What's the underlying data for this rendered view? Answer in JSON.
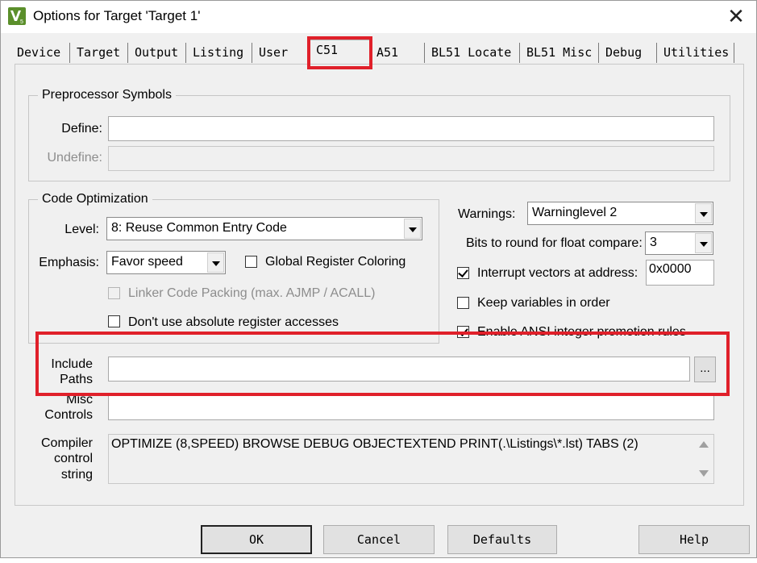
{
  "window": {
    "title": "Options for Target 'Target 1'",
    "close_symbol": "✕"
  },
  "tabs": [
    {
      "label": "Device"
    },
    {
      "label": "Target"
    },
    {
      "label": "Output"
    },
    {
      "label": "Listing"
    },
    {
      "label": "User"
    },
    {
      "label": "C51",
      "active": true
    },
    {
      "label": "A51"
    },
    {
      "label": "BL51 Locate"
    },
    {
      "label": "BL51 Misc"
    },
    {
      "label": "Debug"
    },
    {
      "label": "Utilities"
    }
  ],
  "preprocessor": {
    "title": "Preprocessor Symbols",
    "define_label": "Define:",
    "define_value": "",
    "undefine_label": "Undefine:",
    "undefine_value": ""
  },
  "optimization": {
    "title": "Code Optimization",
    "level_label": "Level:",
    "level_value": "8: Reuse Common Entry Code",
    "emphasis_label": "Emphasis:",
    "emphasis_value": "Favor speed",
    "global_register_coloring": {
      "label": "Global Register Coloring",
      "checked": false
    },
    "linker_code_packing": {
      "label": "Linker Code Packing (max. AJMP / ACALL)",
      "checked": false,
      "enabled": false
    },
    "no_absolute_register": {
      "label": "Don't use absolute register accesses",
      "checked": false
    }
  },
  "right_options": {
    "warnings_label": "Warnings:",
    "warnings_value": "Warninglevel 2",
    "bits_label": "Bits to round for float compare:",
    "bits_value": "3",
    "interrupt_vectors": {
      "label": "Interrupt vectors at address:",
      "checked": true,
      "value": "0x0000"
    },
    "keep_variables": {
      "label": "Keep variables in order",
      "checked": false
    },
    "ansi_integer": {
      "label": "Enable ANSI integer promotion rules",
      "checked": true
    }
  },
  "include_paths": {
    "label_line1": "Include",
    "label_line2": "Paths",
    "value": "",
    "browse_label": "..."
  },
  "misc_controls": {
    "label_line1": "Misc",
    "label_line2": "Controls",
    "value": ""
  },
  "compiler_control": {
    "label_line1": "Compiler",
    "label_line2": "control",
    "label_line3": "string",
    "value": "OPTIMIZE (8,SPEED) BROWSE DEBUG OBJECTEXTEND PRINT(.\\Listings\\*.lst) TABS (2)"
  },
  "buttons": {
    "ok": "OK",
    "cancel": "Cancel",
    "defaults": "Defaults",
    "help": "Help"
  },
  "colors": {
    "highlight": "#e0202a",
    "dialog_bg": "#f0f0f0"
  }
}
